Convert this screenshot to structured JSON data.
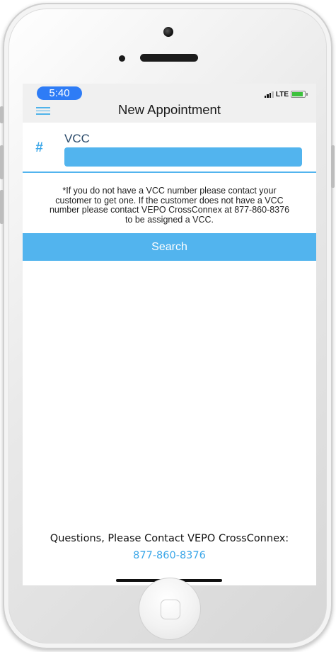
{
  "status_bar": {
    "time": "5:40",
    "network": "LTE"
  },
  "navbar": {
    "title": "New Appointment",
    "menu_icon": "hamburger-menu-icon"
  },
  "form": {
    "hash_icon": "#",
    "vcc_label": "VCC",
    "vcc_value": "",
    "vcc_placeholder": "",
    "info_text": "*If you do not have a VCC number please contact your\ncustomer to get one. If the customer does not have a VCC\nnumber please contact VEPO CrossConnex at 877-860-8376\nto be assigned a VCC.",
    "search_label": "Search"
  },
  "footer": {
    "contact_text": "Questions, Please Contact VEPO CrossConnex:",
    "phone": "877-860-8376"
  },
  "colors": {
    "accent": "#52b4ee",
    "navbar_bg": "#f0f0f0",
    "time_pill": "#2e7cf6"
  }
}
